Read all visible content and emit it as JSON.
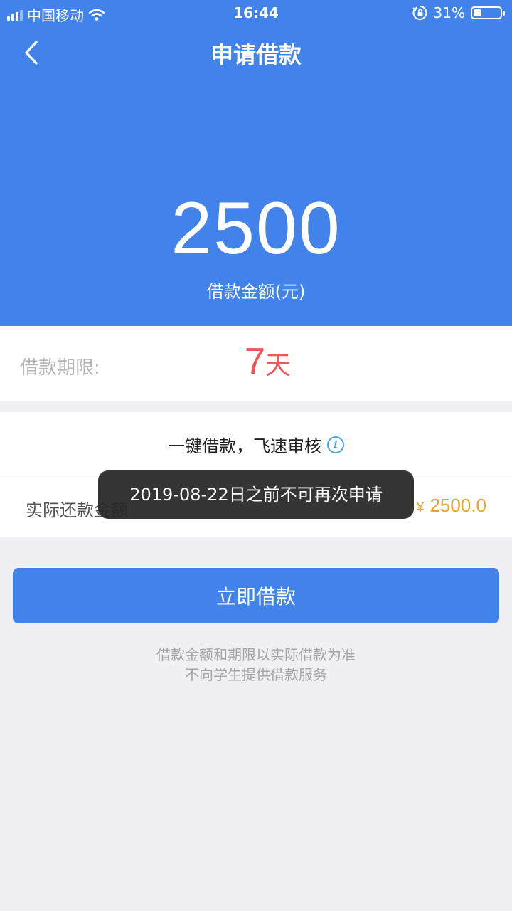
{
  "status_bar": {
    "carrier": "中国移动",
    "time": "16:44",
    "battery": "31%",
    "battery_level": 0.31,
    "icons": [
      "signal-icon",
      "wifi-icon",
      "orientation-lock-icon",
      "battery-icon"
    ]
  },
  "nav": {
    "title": "申请借款",
    "back_icon": "back-chevron-icon"
  },
  "loan": {
    "amount": "2500",
    "amount_label": "借款金额(元)",
    "term_label": "借款期限:",
    "term_number": "7",
    "term_unit": "天"
  },
  "card": {
    "title": "一键借款，飞速审核",
    "info_icon": "info-icon",
    "repay_label": "实际还款金额",
    "repay_currency": "¥",
    "repay_amount": "2500.0"
  },
  "toast": {
    "message": "2019-08-22日之前不可再次申请"
  },
  "actions": {
    "apply_label": "立即借款"
  },
  "notes": {
    "line1": "借款金额和期限以实际借款为准",
    "line2": "不向学生提供借款服务"
  },
  "colors": {
    "primary": "#4183ea",
    "term_accent": "#f25757",
    "amount_accent": "#e4a32d",
    "background": "#efeff4"
  }
}
